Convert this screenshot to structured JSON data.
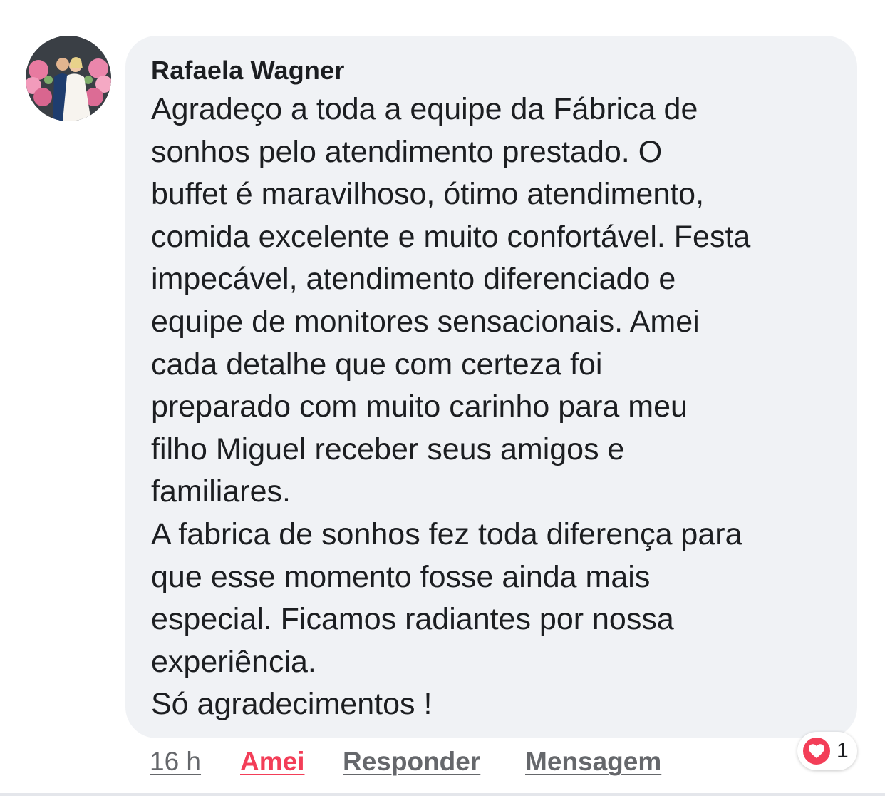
{
  "comment": {
    "author": "Rafaela Wagner",
    "text": "Agradeço a toda a equipe da Fábrica de\nsonhos pelo atendimento prestado. O\nbuffet é maravilhoso, ótimo atendimento,\ncomida excelente e muito confortável. Festa\nimpecável, atendimento diferenciado e\nequipe de monitores sensacionais. Amei\ncada detalhe que com certeza foi\npreparado com muito carinho para meu\nfilho Miguel receber seus amigos e\nfamiliares.\nA fabrica de sonhos fez toda diferença para\nque esse momento fosse ainda mais\nespecial. Ficamos radiantes por nossa\nexperiência.\nSó agradecimentos !"
  },
  "actions": {
    "time": "16 h",
    "amei": "Amei",
    "reply": "Responder",
    "message": "Mensagem"
  },
  "reactions": {
    "icon": "heart-icon",
    "count": "1"
  },
  "colors": {
    "bubble": "#f0f2f5",
    "text": "#1c1e21",
    "muted": "#65676b",
    "love": "#f33e58"
  }
}
